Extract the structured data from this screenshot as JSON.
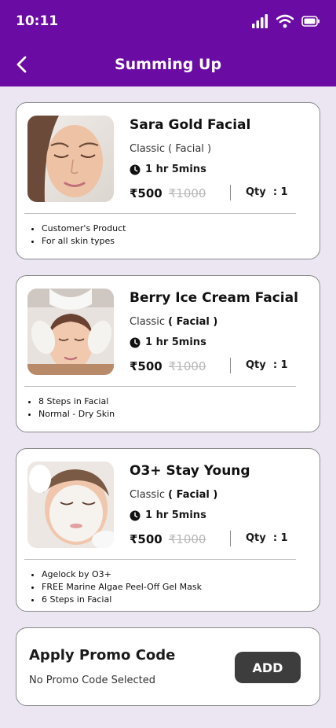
{
  "status_bar": {
    "time": "10:11"
  },
  "header": {
    "title": "Summing Up"
  },
  "items": [
    {
      "name": "Sara Gold Facial",
      "category_prefix": "Classic",
      "category": "( Facial )",
      "duration": "1 hr 5mins",
      "price": "₹500",
      "original_price": "₹1000",
      "qty_label": "Qty",
      "qty_value": ": 1",
      "features": [
        "Customer's Product",
        "For all skin types"
      ]
    },
    {
      "name": "Berry Ice Cream Facial",
      "category_prefix": "Classic",
      "category": "( Facial )",
      "duration": "1 hr 5mins",
      "price": "₹500",
      "original_price": "₹1000",
      "qty_label": "Qty",
      "qty_value": ": 1",
      "features": [
        "8 Steps in Facial",
        "Normal - Dry Skin"
      ]
    },
    {
      "name": "O3+ Stay Young",
      "category_prefix": "Classic",
      "category": "( Facial )",
      "duration": "1 hr 5mins",
      "price": "₹500",
      "original_price": "₹1000",
      "qty_label": "Qty",
      "qty_value": ": 1",
      "features": [
        "Agelock by O3+",
        "FREE Marine Algae Peel-Off Gel Mask",
        "6 Steps in Facial"
      ]
    }
  ],
  "promo": {
    "title": "Apply Promo Code",
    "subtitle": "No Promo Code Selected",
    "button_label": "ADD"
  },
  "colors": {
    "header_bg": "#6A0BA4",
    "page_bg": "#ECE6F3",
    "button_bg": "#3d3d3d"
  }
}
